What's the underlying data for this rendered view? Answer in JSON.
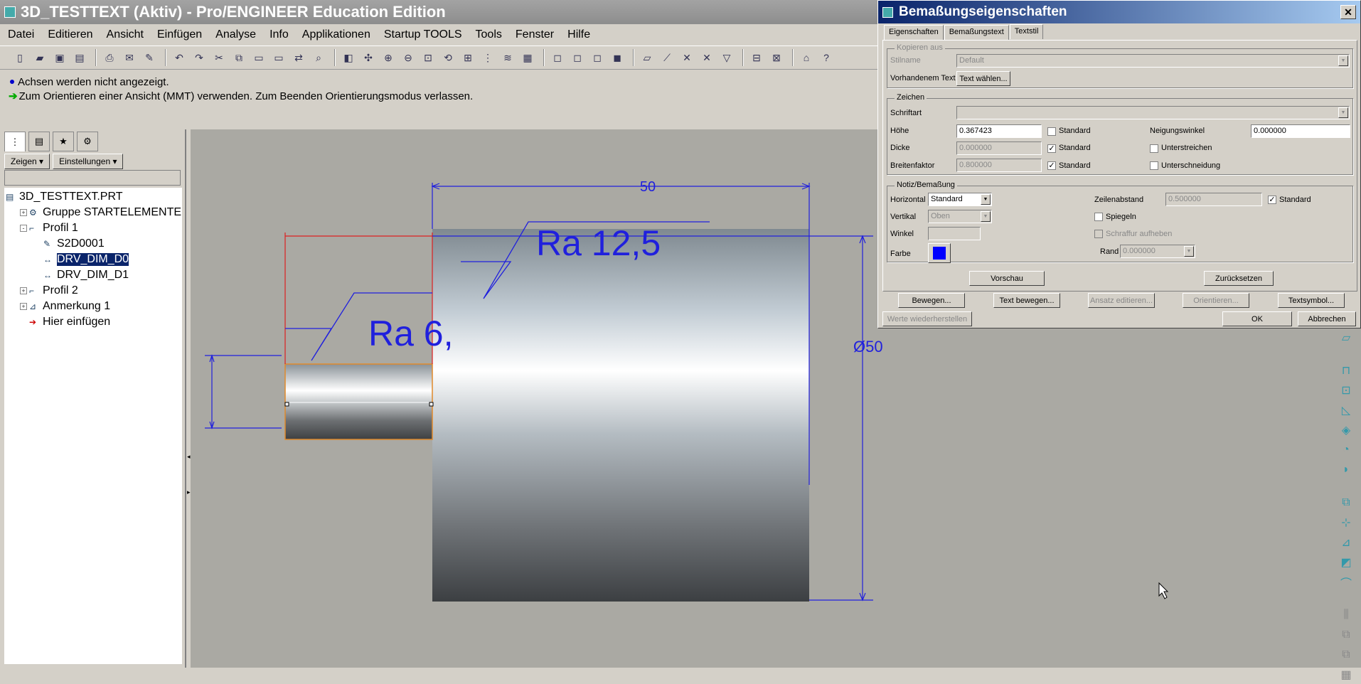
{
  "window": {
    "title": "3D_TESTTEXT (Aktiv) - Pro/ENGINEER Education Edition"
  },
  "menu": [
    "Datei",
    "Editieren",
    "Ansicht",
    "Einfügen",
    "Analyse",
    "Info",
    "Applikationen",
    "Startup TOOLS",
    "Tools",
    "Fenster",
    "Hilfe"
  ],
  "messages": [
    "Achsen werden nicht angezeigt.",
    "Zum Orientieren einer Ansicht (MMT) verwenden. Zum Beenden Orientierungsmodus verlassen."
  ],
  "left_panel": {
    "buttons": [
      "Zeigen",
      "Einstellungen"
    ],
    "tree": [
      {
        "label": "3D_TESTTEXT.PRT",
        "indent": 0,
        "expand": "",
        "icon": "part-icon"
      },
      {
        "label": "Gruppe STARTELEMENTE",
        "indent": 1,
        "expand": "+",
        "icon": "group-icon"
      },
      {
        "label": "Profil 1",
        "indent": 1,
        "expand": "-",
        "icon": "profile-icon"
      },
      {
        "label": "S2D0001",
        "indent": 2,
        "expand": "",
        "icon": "sketch-icon"
      },
      {
        "label": "DRV_DIM_D0",
        "indent": 2,
        "expand": "",
        "icon": "dimension-icon",
        "selected": true
      },
      {
        "label": "DRV_DIM_D1",
        "indent": 2,
        "expand": "",
        "icon": "dimension-icon"
      },
      {
        "label": "Profil 2",
        "indent": 1,
        "expand": "+",
        "icon": "profile-icon"
      },
      {
        "label": "Anmerkung 1",
        "indent": 1,
        "expand": "+",
        "icon": "annotation-icon"
      },
      {
        "label": "Hier einfügen",
        "indent": 1,
        "expand": "",
        "icon": "insert-here-icon"
      }
    ]
  },
  "drawing": {
    "dim_top": "50",
    "surface_top": "Ra 12,5",
    "surface_left": "Ra 6,",
    "dim_right": "Ø50"
  },
  "dialog": {
    "title": "Bemaßungseigenschaften",
    "tabs": [
      "Eigenschaften",
      "Bemaßungstext",
      "Textstil"
    ],
    "copy_group": {
      "legend": "Kopieren aus",
      "stilname_label": "Stilname",
      "stilname_value": "Default",
      "existing_label": "Vorhandenem Text",
      "choose_text_button": "Text wählen..."
    },
    "chars_group": {
      "legend": "Zeichen",
      "font_label": "Schriftart",
      "font_value": "",
      "height_label": "Höhe",
      "height_value": "0.367423",
      "thickness_label": "Dicke",
      "thickness_value": "0.000000",
      "width_label": "Breitenfaktor",
      "width_value": "0.800000",
      "standard": "Standard",
      "slant_label": "Neigungswinkel",
      "slant_value": "0.000000",
      "underline_label": "Unterstreichen",
      "kerning_label": "Unterschneidung"
    },
    "note_group": {
      "legend": "Notiz/Bemaßung",
      "horizontal_label": "Horizontal",
      "horizontal_value": "Standard",
      "vertical_label": "Vertikal",
      "vertical_value": "Oben",
      "angle_label": "Winkel",
      "color_label": "Farbe",
      "color_value": "#0000ff",
      "line_spacing_label": "Zeilenabstand",
      "line_spacing_value": "0.500000",
      "standard": "Standard",
      "mirror_label": "Spiegeln",
      "hatch_label": "Schraffur aufheben",
      "margin_label": "Rand",
      "margin_value": "0.000000"
    },
    "buttons": {
      "preview": "Vorschau",
      "reset": "Zurücksetzen",
      "move": "Bewegen...",
      "move_text": "Text bewegen...",
      "edit_attach": "Ansatz editieren...",
      "orient": "Orientieren...",
      "text_symbol": "Textsymbol...",
      "restore": "Werte wiederherstellen",
      "ok": "OK",
      "cancel": "Abbrechen"
    }
  }
}
